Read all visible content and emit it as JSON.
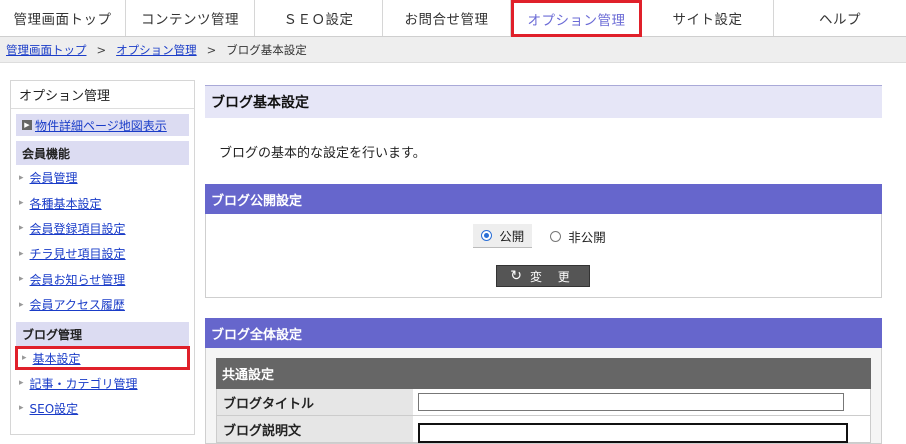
{
  "topnav": {
    "tabs": [
      {
        "label": "管理画面トップ",
        "active": false
      },
      {
        "label": "コンテンツ管理",
        "active": false
      },
      {
        "label": "ＳＥＯ設定",
        "active": false
      },
      {
        "label": "お問合せ管理",
        "active": false
      },
      {
        "label": "オプション管理",
        "active": true
      },
      {
        "label": "サイト設定",
        "active": false
      },
      {
        "label": "ヘルプ",
        "active": false
      }
    ]
  },
  "breadcrumb": {
    "items": [
      "管理画面トップ",
      "オプション管理",
      "ブログ基本設定"
    ],
    "separator": ">"
  },
  "sidebar": {
    "title": "オプション管理",
    "map_link": "物件詳細ページ地図表示",
    "sections": [
      {
        "title": "会員機能",
        "items": [
          "会員管理",
          "各種基本設定",
          "会員登録項目設定",
          "チラ見せ項目設定",
          "会員お知らせ管理",
          "会員アクセス履歴"
        ]
      },
      {
        "title": "ブログ管理",
        "items": [
          "基本設定",
          "記事・カテゴリ管理",
          "SEO設定"
        ]
      }
    ]
  },
  "main": {
    "title": "ブログ基本設定",
    "description": "ブログの基本的な設定を行います。",
    "publish_section": {
      "heading": "ブログ公開設定",
      "options": [
        {
          "label": "公開",
          "checked": true
        },
        {
          "label": "非公開",
          "checked": false
        }
      ],
      "change_button": "変 更"
    },
    "all_section": {
      "heading": "ブログ全体設定",
      "common_heading": "共通設定",
      "rows": [
        {
          "label": "ブログタイトル",
          "value": ""
        },
        {
          "label": "ブログ説明文",
          "value": ""
        }
      ]
    }
  },
  "colors": {
    "accent": "#6666cc",
    "highlight_border": "#e0202a",
    "link": "#1a3cc8"
  }
}
